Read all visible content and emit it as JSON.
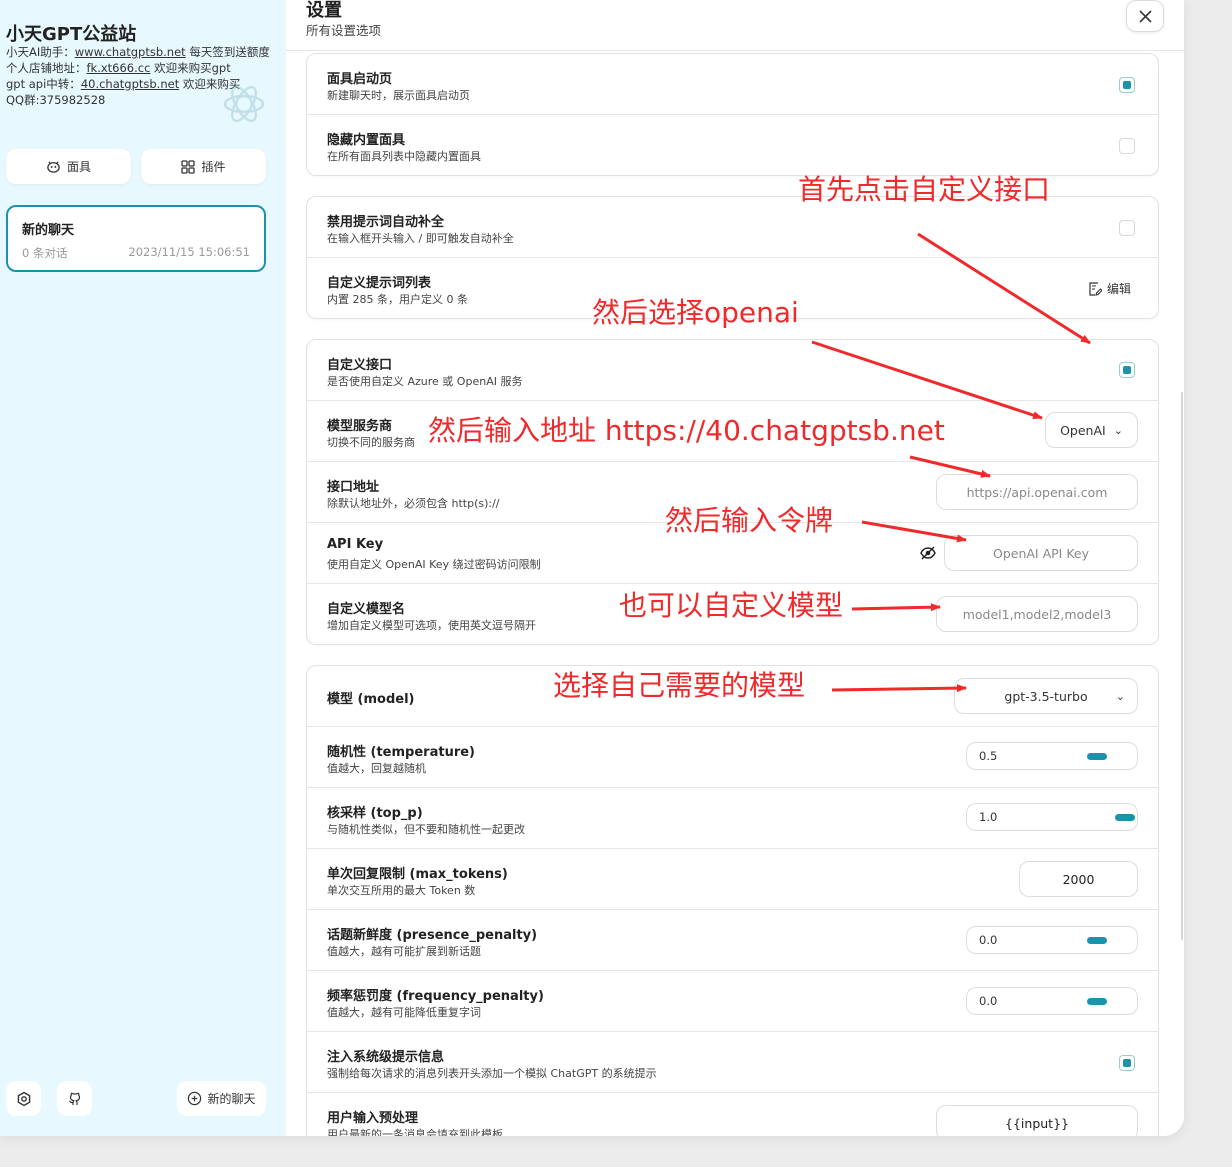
{
  "sidebar": {
    "title": "小天GPT公益站",
    "info": {
      "line1_prefix": "小天AI助手：",
      "line1_link": "www.chatgptsb.net",
      "line1_suffix": " 每天签到送额度",
      "line2_prefix": "个人店铺地址：",
      "line2_link": "fk.xt666.cc",
      "line2_suffix": " 欢迎来购买gpt",
      "line3_prefix": "gpt api中转：",
      "line3_link": "40.chatgptsb.net",
      "line3_suffix": " 欢迎来购买",
      "line4": "QQ群:375982528"
    },
    "mask_button": "面具",
    "plugin_button": "插件",
    "chat": {
      "title": "新的聊天",
      "count": "0 条对话",
      "time": "2023/11/15 15:06:51"
    },
    "new_chat_button": "新的聊天",
    "icons": [
      "settings-icon",
      "github-icon"
    ]
  },
  "settings": {
    "title": "设置",
    "subtitle": "所有设置选项",
    "mask_group": [
      {
        "title": "面具启动页",
        "desc": "新建聊天时，展示面具启动页",
        "checked": true
      },
      {
        "title": "隐藏内置面具",
        "desc": "在所有面具列表中隐藏内置面具",
        "checked": false
      }
    ],
    "prompt_group": {
      "disable_autocomplete": {
        "title": "禁用提示词自动补全",
        "desc": "在输入框开头输入 / 即可触发自动补全",
        "checked": false
      },
      "custom_prompts": {
        "title": "自定义提示词列表",
        "desc": "内置 285 条，用户定义 0 条",
        "edit_label": "编辑"
      }
    },
    "api_group": {
      "custom_api": {
        "title": "自定义接口",
        "desc": "是否使用自定义 Azure 或 OpenAI 服务",
        "checked": true
      },
      "provider": {
        "title": "模型服务商",
        "desc": "切换不同的服务商",
        "value": "OpenAI"
      },
      "endpoint": {
        "title": "接口地址",
        "desc": "除默认地址外，必须包含 http(s)://",
        "placeholder": "https://api.openai.com"
      },
      "api_key": {
        "title": "API Key",
        "desc": "使用自定义 OpenAI Key 绕过密码访问限制",
        "placeholder": "OpenAI API Key"
      },
      "custom_models": {
        "title": "自定义模型名",
        "desc": "增加自定义模型可选项，使用英文逗号隔开",
        "placeholder": "model1,model2,model3"
      }
    },
    "model_group": {
      "model": {
        "title": "模型 (model)",
        "value": "gpt-3.5-turbo"
      },
      "temperature": {
        "title": "随机性 (temperature)",
        "desc": "值越大，回复越随机",
        "value": "0.5",
        "level": 0.5
      },
      "top_p": {
        "title": "核采样 (top_p)",
        "desc": "与随机性类似，但不要和随机性一起更改",
        "value": "1.0",
        "level": 1.0
      },
      "max_tokens": {
        "title": "单次回复限制 (max_tokens)",
        "desc": "单次交互所用的最大 Token 数",
        "value": "2000"
      },
      "presence_penalty": {
        "title": "话题新鲜度 (presence_penalty)",
        "desc": "值越大，越有可能扩展到新话题",
        "value": "0.0",
        "level": 0.5
      },
      "frequency_penalty": {
        "title": "频率惩罚度 (frequency_penalty)",
        "desc": "值越大，越有可能降低重复字词",
        "value": "0.0",
        "level": 0.5
      },
      "inject_system": {
        "title": "注入系统级提示信息",
        "desc": "强制给每次请求的消息列表开头添加一个模拟 ChatGPT 的系统提示",
        "checked": true
      },
      "input_template": {
        "title": "用户输入预处理",
        "desc": "用户最新的一条消息会填充到此模板",
        "value": "{{input}}"
      }
    }
  },
  "annotations": {
    "step1": "首先点击自定义接口",
    "step2": "然后选择openai",
    "step3": "然后输入地址 https://40.chatgptsb.net",
    "step4": "然后输入令牌",
    "step5": "也可以自定义模型",
    "step6": "选择自己需要的模型",
    "color": "#f0292b"
  },
  "colors": {
    "accent": "#1d93ab",
    "sidebar_bg": "#e7f8ff"
  }
}
